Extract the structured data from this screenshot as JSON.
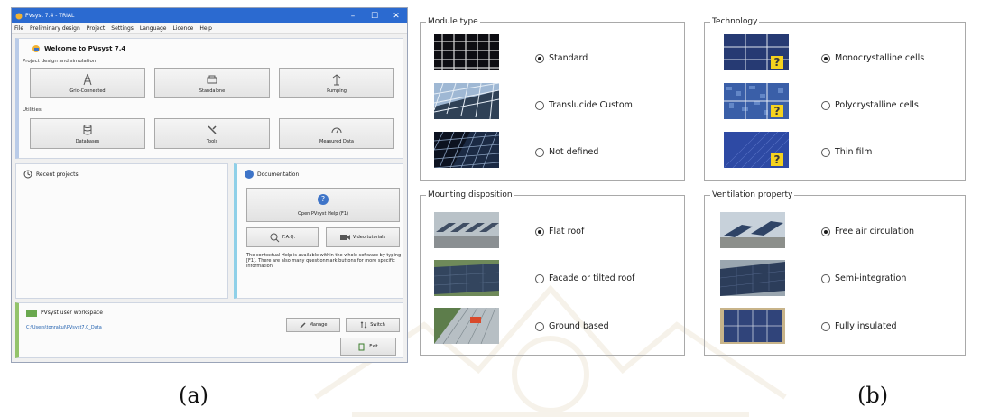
{
  "window": {
    "title": "PVsyst 7.4 - TRIAL",
    "controls": [
      "–",
      "☐",
      "✕"
    ],
    "menu": [
      "File",
      "Preliminary design",
      "Project",
      "Settings",
      "Language",
      "Licence",
      "Help"
    ]
  },
  "welcome": {
    "title": "Welcome to PVsyst 7.4",
    "section_design": "Project design and simulation",
    "section_utilities": "Utilities",
    "design_buttons": [
      {
        "label": "Grid-Connected",
        "icon": "grid-tower-icon"
      },
      {
        "label": "Standalone",
        "icon": "standalone-battery-icon"
      },
      {
        "label": "Pumping",
        "icon": "pump-icon"
      }
    ],
    "utility_buttons": [
      {
        "label": "Databases",
        "icon": "database-icon"
      },
      {
        "label": "Tools",
        "icon": "tools-icon"
      },
      {
        "label": "Measured Data",
        "icon": "gauge-icon"
      }
    ]
  },
  "recent": {
    "title": "Recent projects",
    "icon": "clock-icon"
  },
  "docs": {
    "title": "Documentation",
    "icon": "info-icon",
    "help_button": "Open PVsyst Help (F1)",
    "faq_button": "F.A.Q.",
    "video_button": "Video tutorials",
    "text": "The contextual Help is available within the whole software by typing [F1]. There are also many questionmark buttons for more specific information."
  },
  "workspace": {
    "title": "PVsyst user workspace",
    "path": "C:\\Users\\tonrakul\\PVsyst7.0_Data",
    "manage_button": "Manage",
    "switch_button": "Switch",
    "exit_button": "Exit"
  },
  "groups": {
    "module_type": {
      "title": "Module type",
      "options": [
        {
          "label": "Standard",
          "selected": true
        },
        {
          "label": "Translucide Custom",
          "selected": false
        },
        {
          "label": "Not defined",
          "selected": false
        }
      ]
    },
    "technology": {
      "title": "Technology",
      "options": [
        {
          "label": "Monocrystalline cells",
          "selected": true
        },
        {
          "label": "Polycrystalline cells",
          "selected": false
        },
        {
          "label": "Thin film",
          "selected": false
        }
      ]
    },
    "mounting": {
      "title": "Mounting disposition",
      "options": [
        {
          "label": "Flat roof",
          "selected": true
        },
        {
          "label": "Facade or tilted roof",
          "selected": false
        },
        {
          "label": "Ground based",
          "selected": false
        }
      ]
    },
    "ventilation": {
      "title": "Ventilation property",
      "options": [
        {
          "label": "Free air circulation",
          "selected": true
        },
        {
          "label": "Semi-integration",
          "selected": false
        },
        {
          "label": "Fully insulated",
          "selected": false
        }
      ]
    }
  },
  "captions": {
    "a": "(a)",
    "b": "(b)"
  },
  "colors": {
    "titlebar": "#2b6ad0",
    "accent_blue": "#3e74c8",
    "workspace_green": "#93c36b"
  }
}
